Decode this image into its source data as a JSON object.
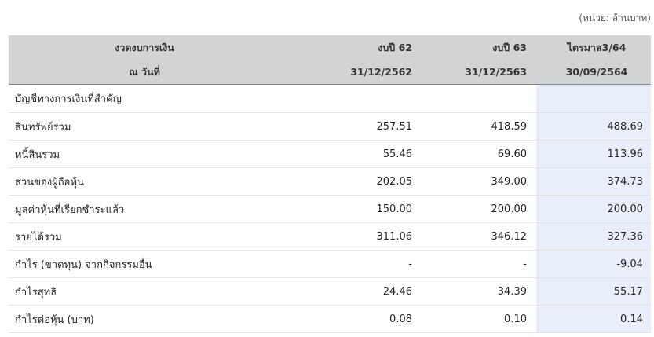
{
  "unit_note": "(หน่วย: ล้านบาท)",
  "header": {
    "row1": [
      "งวดงบการเงิน",
      "งบปี 62",
      "งบปี 63",
      "ไตรมาส3/64"
    ],
    "row2": [
      "ณ วันที่",
      "31/12/2562",
      "31/12/2563",
      "30/09/2564"
    ]
  },
  "section_title": "บัญชีทางการเงินที่สำคัญ",
  "rows": [
    {
      "label": "สินทรัพย์รวม",
      "v62": "257.51",
      "v63": "418.59",
      "q3_64": "488.69"
    },
    {
      "label": "หนี้สินรวม",
      "v62": "55.46",
      "v63": "69.60",
      "q3_64": "113.96"
    },
    {
      "label": "ส่วนของผู้ถือหุ้น",
      "v62": "202.05",
      "v63": "349.00",
      "q3_64": "374.73"
    },
    {
      "label": "มูลค่าหุ้นที่เรียกชำระแล้ว",
      "v62": "150.00",
      "v63": "200.00",
      "q3_64": "200.00"
    },
    {
      "label": "รายได้รวม",
      "v62": "311.06",
      "v63": "346.12",
      "q3_64": "327.36"
    },
    {
      "label": "กำไร (ขาดทุน) จากกิจกรรมอื่น",
      "v62": "-",
      "v63": "-",
      "q3_64": "-9.04"
    },
    {
      "label": "กำไรสุทธิ",
      "v62": "24.46",
      "v63": "34.39",
      "q3_64": "55.17"
    },
    {
      "label": "กำไรต่อหุ้น (บาท)",
      "v62": "0.08",
      "v63": "0.10",
      "q3_64": "0.14"
    }
  ],
  "colors": {
    "header_bg": "#d1d3d4",
    "header_rule": "#4caf50",
    "highlight_col": "#e8eefa"
  }
}
